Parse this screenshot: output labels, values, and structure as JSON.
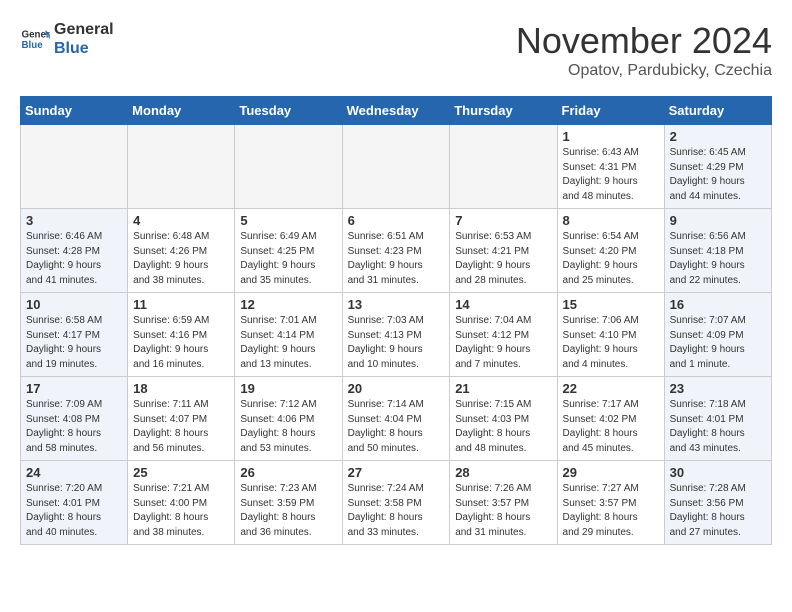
{
  "logo": {
    "line1": "General",
    "line2": "Blue"
  },
  "title": "November 2024",
  "subtitle": "Opatov, Pardubicky, Czechia",
  "days_header": [
    "Sunday",
    "Monday",
    "Tuesday",
    "Wednesday",
    "Thursday",
    "Friday",
    "Saturday"
  ],
  "weeks": [
    [
      {
        "day": "",
        "info": ""
      },
      {
        "day": "",
        "info": ""
      },
      {
        "day": "",
        "info": ""
      },
      {
        "day": "",
        "info": ""
      },
      {
        "day": "",
        "info": ""
      },
      {
        "day": "1",
        "info": "Sunrise: 6:43 AM\nSunset: 4:31 PM\nDaylight: 9 hours\nand 48 minutes."
      },
      {
        "day": "2",
        "info": "Sunrise: 6:45 AM\nSunset: 4:29 PM\nDaylight: 9 hours\nand 44 minutes."
      }
    ],
    [
      {
        "day": "3",
        "info": "Sunrise: 6:46 AM\nSunset: 4:28 PM\nDaylight: 9 hours\nand 41 minutes."
      },
      {
        "day": "4",
        "info": "Sunrise: 6:48 AM\nSunset: 4:26 PM\nDaylight: 9 hours\nand 38 minutes."
      },
      {
        "day": "5",
        "info": "Sunrise: 6:49 AM\nSunset: 4:25 PM\nDaylight: 9 hours\nand 35 minutes."
      },
      {
        "day": "6",
        "info": "Sunrise: 6:51 AM\nSunset: 4:23 PM\nDaylight: 9 hours\nand 31 minutes."
      },
      {
        "day": "7",
        "info": "Sunrise: 6:53 AM\nSunset: 4:21 PM\nDaylight: 9 hours\nand 28 minutes."
      },
      {
        "day": "8",
        "info": "Sunrise: 6:54 AM\nSunset: 4:20 PM\nDaylight: 9 hours\nand 25 minutes."
      },
      {
        "day": "9",
        "info": "Sunrise: 6:56 AM\nSunset: 4:18 PM\nDaylight: 9 hours\nand 22 minutes."
      }
    ],
    [
      {
        "day": "10",
        "info": "Sunrise: 6:58 AM\nSunset: 4:17 PM\nDaylight: 9 hours\nand 19 minutes."
      },
      {
        "day": "11",
        "info": "Sunrise: 6:59 AM\nSunset: 4:16 PM\nDaylight: 9 hours\nand 16 minutes."
      },
      {
        "day": "12",
        "info": "Sunrise: 7:01 AM\nSunset: 4:14 PM\nDaylight: 9 hours\nand 13 minutes."
      },
      {
        "day": "13",
        "info": "Sunrise: 7:03 AM\nSunset: 4:13 PM\nDaylight: 9 hours\nand 10 minutes."
      },
      {
        "day": "14",
        "info": "Sunrise: 7:04 AM\nSunset: 4:12 PM\nDaylight: 9 hours\nand 7 minutes."
      },
      {
        "day": "15",
        "info": "Sunrise: 7:06 AM\nSunset: 4:10 PM\nDaylight: 9 hours\nand 4 minutes."
      },
      {
        "day": "16",
        "info": "Sunrise: 7:07 AM\nSunset: 4:09 PM\nDaylight: 9 hours\nand 1 minute."
      }
    ],
    [
      {
        "day": "17",
        "info": "Sunrise: 7:09 AM\nSunset: 4:08 PM\nDaylight: 8 hours\nand 58 minutes."
      },
      {
        "day": "18",
        "info": "Sunrise: 7:11 AM\nSunset: 4:07 PM\nDaylight: 8 hours\nand 56 minutes."
      },
      {
        "day": "19",
        "info": "Sunrise: 7:12 AM\nSunset: 4:06 PM\nDaylight: 8 hours\nand 53 minutes."
      },
      {
        "day": "20",
        "info": "Sunrise: 7:14 AM\nSunset: 4:04 PM\nDaylight: 8 hours\nand 50 minutes."
      },
      {
        "day": "21",
        "info": "Sunrise: 7:15 AM\nSunset: 4:03 PM\nDaylight: 8 hours\nand 48 minutes."
      },
      {
        "day": "22",
        "info": "Sunrise: 7:17 AM\nSunset: 4:02 PM\nDaylight: 8 hours\nand 45 minutes."
      },
      {
        "day": "23",
        "info": "Sunrise: 7:18 AM\nSunset: 4:01 PM\nDaylight: 8 hours\nand 43 minutes."
      }
    ],
    [
      {
        "day": "24",
        "info": "Sunrise: 7:20 AM\nSunset: 4:01 PM\nDaylight: 8 hours\nand 40 minutes."
      },
      {
        "day": "25",
        "info": "Sunrise: 7:21 AM\nSunset: 4:00 PM\nDaylight: 8 hours\nand 38 minutes."
      },
      {
        "day": "26",
        "info": "Sunrise: 7:23 AM\nSunset: 3:59 PM\nDaylight: 8 hours\nand 36 minutes."
      },
      {
        "day": "27",
        "info": "Sunrise: 7:24 AM\nSunset: 3:58 PM\nDaylight: 8 hours\nand 33 minutes."
      },
      {
        "day": "28",
        "info": "Sunrise: 7:26 AM\nSunset: 3:57 PM\nDaylight: 8 hours\nand 31 minutes."
      },
      {
        "day": "29",
        "info": "Sunrise: 7:27 AM\nSunset: 3:57 PM\nDaylight: 8 hours\nand 29 minutes."
      },
      {
        "day": "30",
        "info": "Sunrise: 7:28 AM\nSunset: 3:56 PM\nDaylight: 8 hours\nand 27 minutes."
      }
    ]
  ]
}
